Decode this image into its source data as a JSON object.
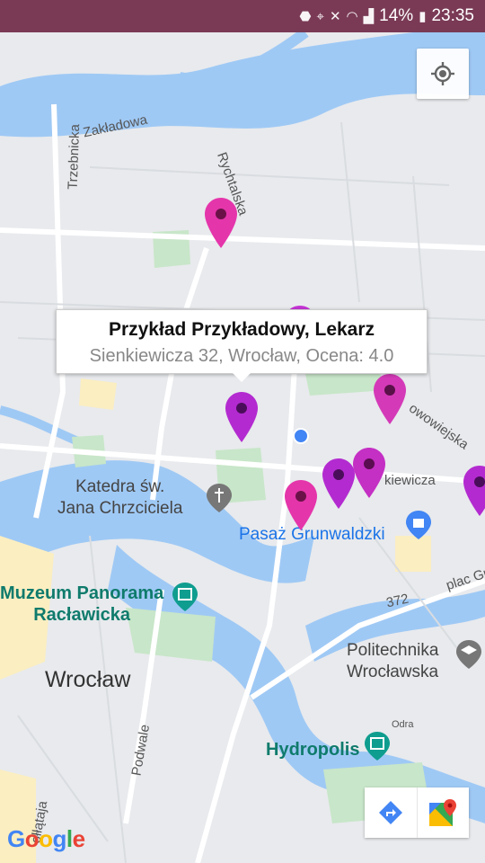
{
  "status_bar": {
    "battery": "14%",
    "time": "23:35",
    "icons": [
      "vpn-icon",
      "location-icon",
      "mute-icon",
      "wifi-icon",
      "signal-icon",
      "battery-icon"
    ]
  },
  "map": {
    "streets": [
      "Zakładowa",
      "Trzebnicka",
      "Rychtalska",
      "owowiejska",
      "kiewicza",
      "372",
      "plac Gr",
      "Odra",
      "Podwale",
      "ołłątaja"
    ],
    "pois": {
      "katedra": "Katedra św.\nJana Chrzciciela",
      "pasaz": "Pasaż Grunwaldzki",
      "muzeum": "Muzeum Panorama\nRacławicka",
      "politechnika": "Politechnika\nWrocławska",
      "hydropolis": "Hydropolis"
    },
    "city": "Wrocław",
    "markers": [
      {
        "color": "#e535ab"
      },
      {
        "color": "#c634d6"
      },
      {
        "color": "#b32bd0"
      },
      {
        "color": "#d43ab8"
      },
      {
        "color": "#e535ab"
      },
      {
        "color": "#b32bd0"
      },
      {
        "color": "#c42fc4"
      },
      {
        "color": "#b32bd0"
      }
    ]
  },
  "info_window": {
    "title": "Przykład Przykładowy, Lekarz",
    "snippet": "Sienkiewicza 32, Wrocław, Ocena: 4.0"
  },
  "controls": {
    "my_location": "my-location-icon",
    "directions": "directions-icon",
    "open_maps": "google-maps-icon"
  },
  "attribution": "Google",
  "colors": {
    "status_bar": "#7a3a55",
    "water": "#9fc9f5",
    "park": "#c8e6c9",
    "land": "#e8eaed"
  }
}
